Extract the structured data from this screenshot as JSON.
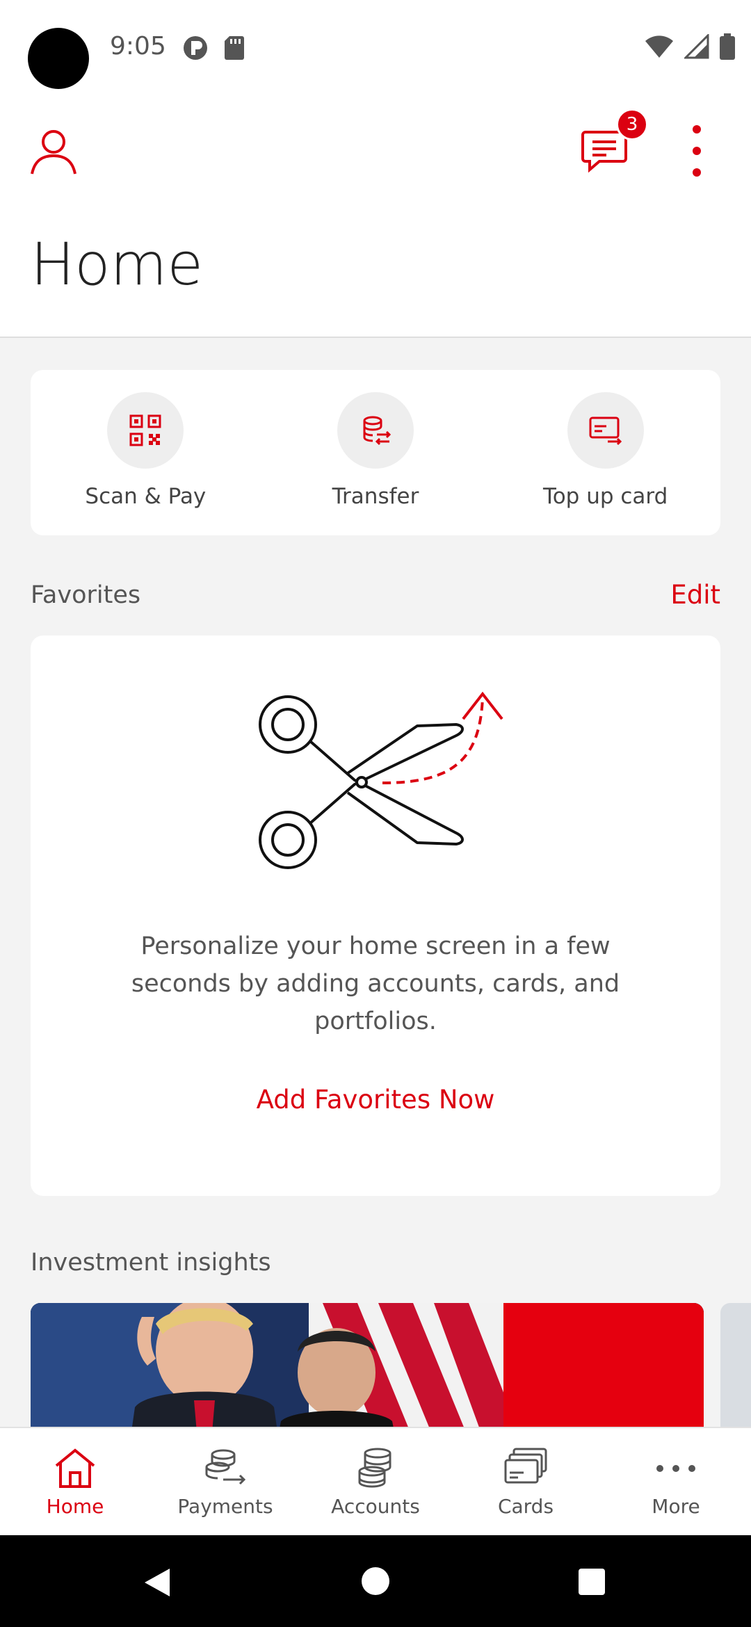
{
  "status_bar": {
    "time": "9:05"
  },
  "header": {
    "title": "Home",
    "messages_badge": "3",
    "icons": [
      "person-icon",
      "chat-icon",
      "kebab-menu-icon"
    ]
  },
  "quick_actions": [
    {
      "label": "Scan & Pay",
      "icon": "qr-code-icon"
    },
    {
      "label": "Transfer",
      "icon": "coins-transfer-icon"
    },
    {
      "label": "Top up card",
      "icon": "card-top-up-icon"
    }
  ],
  "favorites": {
    "title": "Favorites",
    "edit_label": "Edit",
    "message": "Personalize your home screen in a few seconds by adding accounts, cards, and portfolios.",
    "cta": "Add Favorites Now",
    "illustration": "scissors-icon"
  },
  "insights": {
    "title": "Investment insights"
  },
  "bottom_nav": [
    {
      "label": "Home",
      "icon": "home-icon",
      "active": true
    },
    {
      "label": "Payments",
      "icon": "payments-icon",
      "active": false
    },
    {
      "label": "Accounts",
      "icon": "accounts-icon",
      "active": false
    },
    {
      "label": "Cards",
      "icon": "cards-icon",
      "active": false
    },
    {
      "label": "More",
      "icon": "more-dots-icon",
      "active": false
    }
  ],
  "colors": {
    "brand_red": "#db0011",
    "background": "#f3f3f3"
  }
}
